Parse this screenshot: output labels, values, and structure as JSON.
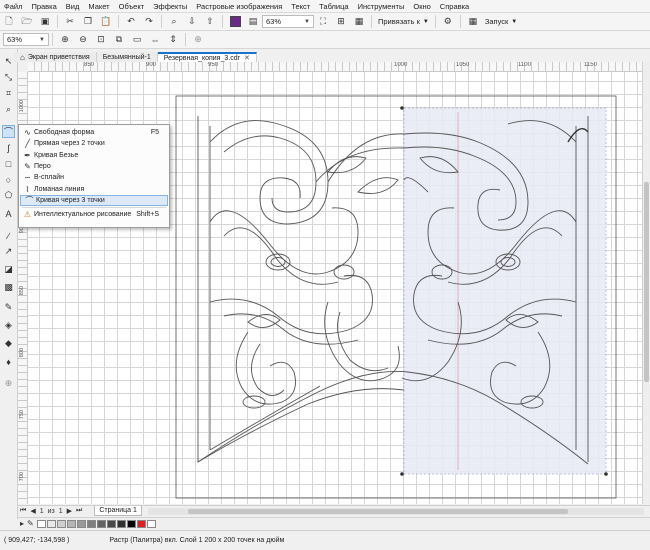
{
  "menu": [
    "Файл",
    "Правка",
    "Вид",
    "Макет",
    "Объект",
    "Эффекты",
    "Растровые изображения",
    "Текст",
    "Таблица",
    "Инструменты",
    "Окно",
    "Справка"
  ],
  "toolbar1": {
    "zoom_value": "63%",
    "snap_label": "Привязать к",
    "launch_label": "Запуск"
  },
  "toolbar2": {
    "zoom_value": "63%"
  },
  "tabs": [
    {
      "label": "Экран приветствия",
      "icon": "home-icon"
    },
    {
      "label": "Безымянный-1"
    },
    {
      "label": "Резервная_копия_3.cdr",
      "active": true
    }
  ],
  "hruler_labels": [
    "850",
    "900",
    "950",
    "1000",
    "1050",
    "1100",
    "1150"
  ],
  "vruler_labels": [
    "1000",
    "950",
    "900",
    "850",
    "800",
    "750",
    "700"
  ],
  "flyout": [
    {
      "label": "Свободная форма",
      "shortcut": "F5",
      "icon": "freehand-icon"
    },
    {
      "label": "Прямая через 2 точки",
      "shortcut": "",
      "icon": "line-2pt-icon"
    },
    {
      "label": "Кривая Безье",
      "shortcut": "",
      "icon": "bezier-icon"
    },
    {
      "label": "Перо",
      "shortcut": "",
      "icon": "pen-icon"
    },
    {
      "label": "B-сплайн",
      "shortcut": "",
      "icon": "bspline-icon"
    },
    {
      "label": "Ломаная линия",
      "shortcut": "",
      "icon": "polyline-icon"
    },
    {
      "label": "Кривая через 3 точки",
      "shortcut": "",
      "icon": "curve-3pt-icon",
      "highlighted": true
    },
    {
      "label": "Интеллектуальное рисование",
      "shortcut": "Shift+S",
      "icon": "smart-draw-icon"
    }
  ],
  "pagebar": {
    "page_counter": "1",
    "of_label": "из",
    "total": "1",
    "page_tab": "Страница 1"
  },
  "palette": [
    "#ffffff",
    "#e8e8e8",
    "#cfcfcf",
    "#b5b5b5",
    "#9a9a9a",
    "#7f7f7f",
    "#646464",
    "#4a4a4a",
    "#303030",
    "#000000",
    "#e02020",
    "#ffffff"
  ],
  "status": {
    "coords": "( 909,427; -134,598 )",
    "info": "Растр (Палитра) вкл. Слой 1 200 x 200 точек на дюйм"
  }
}
